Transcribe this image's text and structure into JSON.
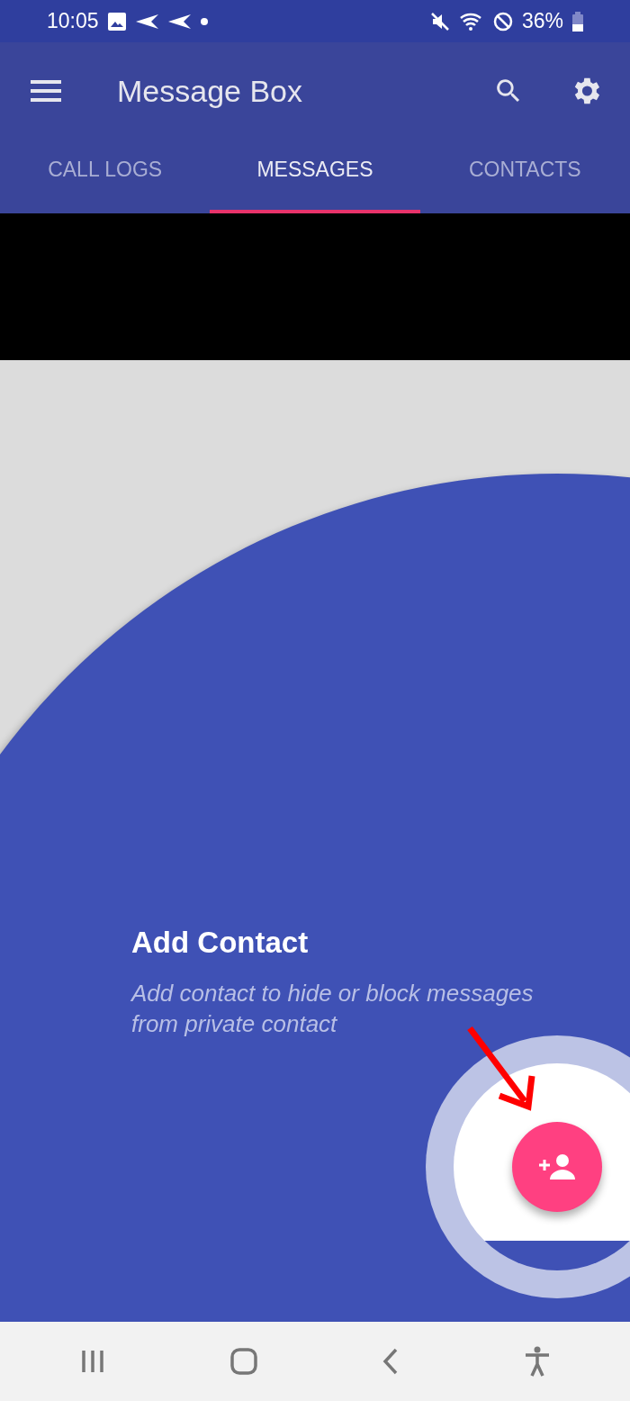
{
  "status_bar": {
    "time": "10:05",
    "battery": "36%"
  },
  "app_bar": {
    "title": "Message Box"
  },
  "tabs": [
    {
      "label": "CALL LOGS",
      "selected": false
    },
    {
      "label": "MESSAGES",
      "selected": true
    },
    {
      "label": "CONTACTS",
      "selected": false
    }
  ],
  "coach_mark": {
    "title": "Add Contact",
    "description": "Add contact to hide or block messages from private contact"
  }
}
